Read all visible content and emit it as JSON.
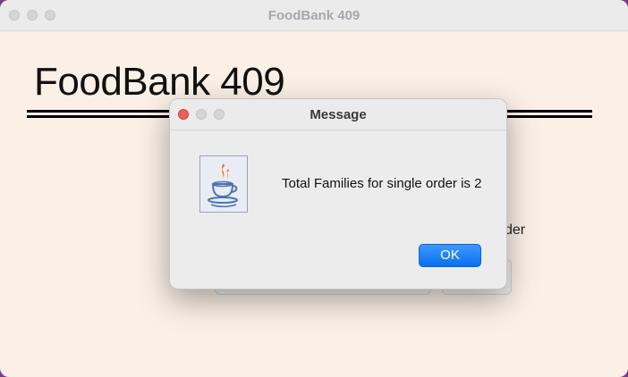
{
  "window": {
    "title": "FoodBank 409"
  },
  "app": {
    "heading": "FoodBank 409",
    "partial_label": "der"
  },
  "dialog": {
    "title": "Message",
    "message": "Total Families for single order is 2",
    "ok_label": "OK",
    "icon": "java-icon"
  },
  "colors": {
    "window_bg": "#faf0e6",
    "ok_button": "#0a6ff0",
    "close_light": "#ec5f57"
  }
}
